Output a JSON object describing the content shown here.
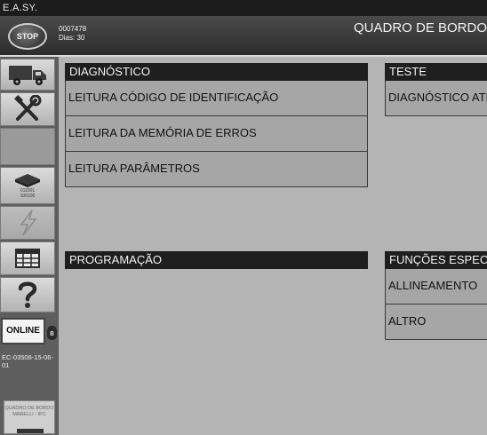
{
  "window": {
    "title": "E.A.SY."
  },
  "header": {
    "stop_label": "STOP",
    "code": "0007478",
    "days": "Dias: 30",
    "title": "QUADRO DE BORDO"
  },
  "sidebar": {
    "chip_text": "011001 100100",
    "online_label": "ONLINE",
    "bluetooth_symbol": "ʙ",
    "ecu_code": "EC-03506-15-06-01",
    "ecu_card_text": "QUADRO DE BORDO MARELLI - IPC"
  },
  "panels": {
    "diagnostico": {
      "title": "DIAGNÓSTICO",
      "items": [
        "LEITURA CÓDIGO DE IDENTIFICAÇÃO",
        "LEITURA DA MEMÓRIA DE ERROS",
        "LEITURA PARÂMETROS"
      ]
    },
    "teste": {
      "title": "TESTE",
      "items": [
        "DIAGNÓSTICO ATIVO"
      ]
    },
    "programacao": {
      "title": "PROGRAMAÇÃO",
      "items": []
    },
    "funcoes": {
      "title": "FUNÇÕES ESPECIAIS",
      "items": [
        "ALLINEAMENTO",
        "ALTRO"
      ]
    }
  },
  "colors": {
    "background": "#b4b4b4",
    "panel_header": "#1e1e1e",
    "panel_item": "#a6a6a6",
    "sidebar": "#5e5e5e"
  }
}
